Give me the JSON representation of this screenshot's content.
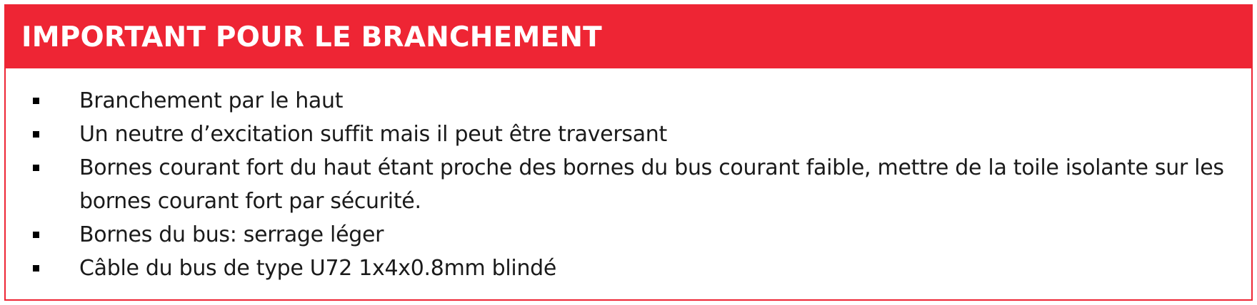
{
  "notice": {
    "title": "IMPORTANT POUR LE BRANCHEMENT",
    "accent_color": "#ee2534",
    "bullet_icon": "square-bullet-icon",
    "items": [
      {
        "text": "Branchement par le haut"
      },
      {
        "text": "Un neutre d’excitation suffit mais il peut être traversant"
      },
      {
        "text": "Bornes courant fort du haut étant proche des bornes du bus courant faible, mettre de la toile isolante sur les bornes courant fort par sécurité."
      },
      {
        "text": "Bornes du bus: serrage léger"
      },
      {
        "text": "Câble du bus de type U72 1x4x0.8mm blindé"
      }
    ]
  }
}
